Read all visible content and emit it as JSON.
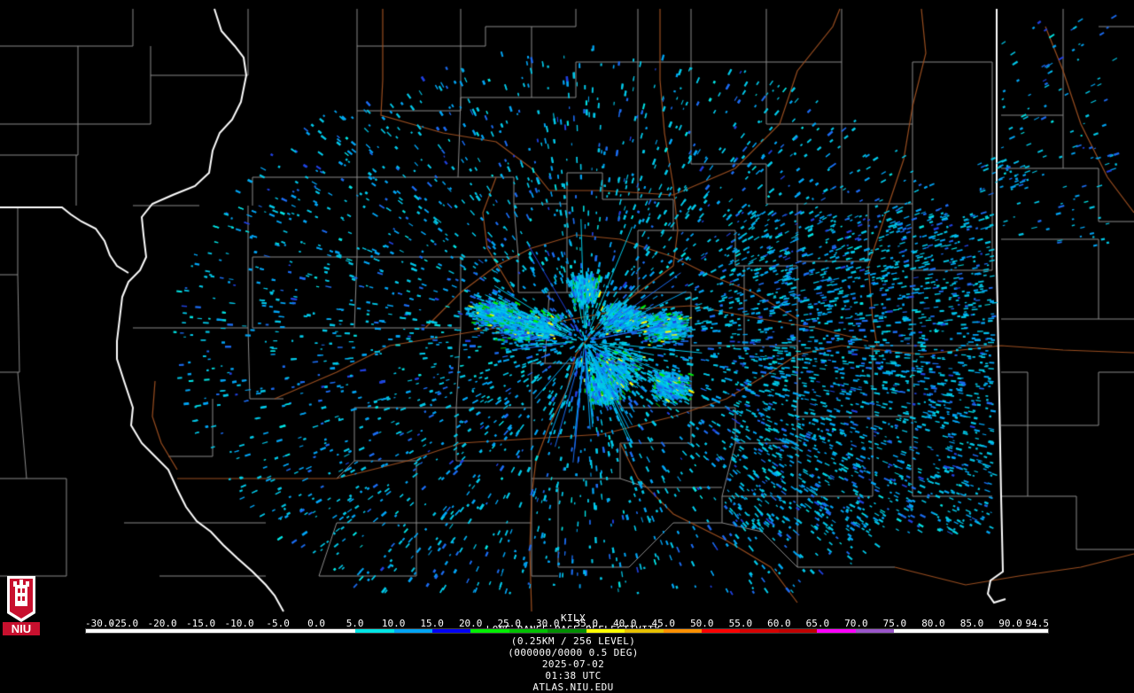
{
  "product": {
    "site": "KILX",
    "product_name": "LONG RANGE BASE REFLECTIVITY",
    "resolution": "(0.25KM / 256 LEVEL)",
    "volume": "(000000/0000 0.5 DEG)",
    "date": "2025-07-02",
    "time": "01:38 UTC",
    "source": "ATLAS.NIU.EDU"
  },
  "logo": {
    "text": "NIU",
    "colors": {
      "background": "#c8102e",
      "text": "#ffffff"
    }
  },
  "scale": {
    "unit": "dBZ",
    "labels": [
      "-30.0",
      "-25.0",
      "-20.0",
      "-15.0",
      "-10.0",
      "-5.0",
      "0.0",
      "5.0",
      "10.0",
      "15.0",
      "20.0",
      "25.0",
      "30.0",
      "35.0",
      "40.0",
      "45.0",
      "50.0",
      "55.0",
      "60.0",
      "65.0",
      "70.0",
      "75.0",
      "80.0",
      "85.0",
      "90.0",
      "94.5"
    ],
    "colors": [
      "#000000",
      "#000000",
      "#000000",
      "#000000",
      "#000000",
      "#000000",
      "#000000",
      "#00e5e5",
      "#00a4f4",
      "#0000f4",
      "#00ee00",
      "#00c000",
      "#008e00",
      "#ffff00",
      "#e7c000",
      "#ff9000",
      "#ff0000",
      "#d60000",
      "#c00000",
      "#ff00ff",
      "#9955c9",
      "#ffffff",
      "#ffffff",
      "#ffffff",
      "#ffffff"
    ]
  },
  "map_colors": {
    "state_border": "#ffffff",
    "county_border": "#8a8a8a",
    "highway": "#9a4e20",
    "background": "#000000"
  }
}
